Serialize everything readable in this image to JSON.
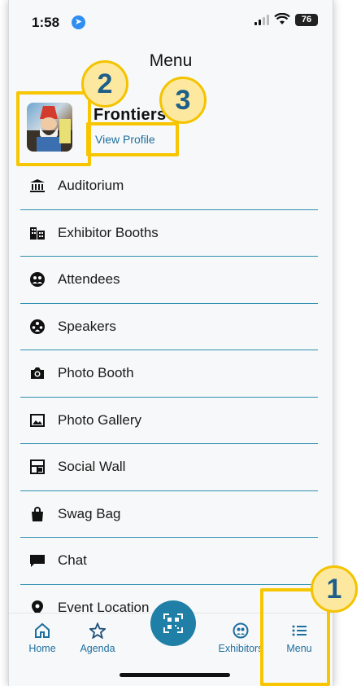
{
  "status_bar": {
    "time": "1:58",
    "battery": "76"
  },
  "header": {
    "title": "Menu"
  },
  "profile": {
    "name": "Frontiers",
    "link": "View Profile"
  },
  "menu_items": [
    {
      "label": "Auditorium",
      "icon": "building-columns-icon"
    },
    {
      "label": "Exhibitor Booths",
      "icon": "booths-icon"
    },
    {
      "label": "Attendees",
      "icon": "attendees-icon"
    },
    {
      "label": "Speakers",
      "icon": "speakers-icon"
    },
    {
      "label": "Photo Booth",
      "icon": "camera-icon"
    },
    {
      "label": "Photo Gallery",
      "icon": "image-icon"
    },
    {
      "label": "Social Wall",
      "icon": "social-wall-icon"
    },
    {
      "label": "Swag Bag",
      "icon": "bag-icon"
    },
    {
      "label": "Chat",
      "icon": "chat-icon"
    },
    {
      "label": "Event Location",
      "icon": "location-pin-icon"
    }
  ],
  "tabbar": {
    "home": "Home",
    "agenda": "Agenda",
    "exhibitors": "Exhibitors",
    "menu": "Menu"
  },
  "callouts": [
    "1",
    "2",
    "3"
  ],
  "colors": {
    "accent": "#1f7fa6",
    "divider": "#2f8fb0",
    "highlight": "#f7c600"
  }
}
